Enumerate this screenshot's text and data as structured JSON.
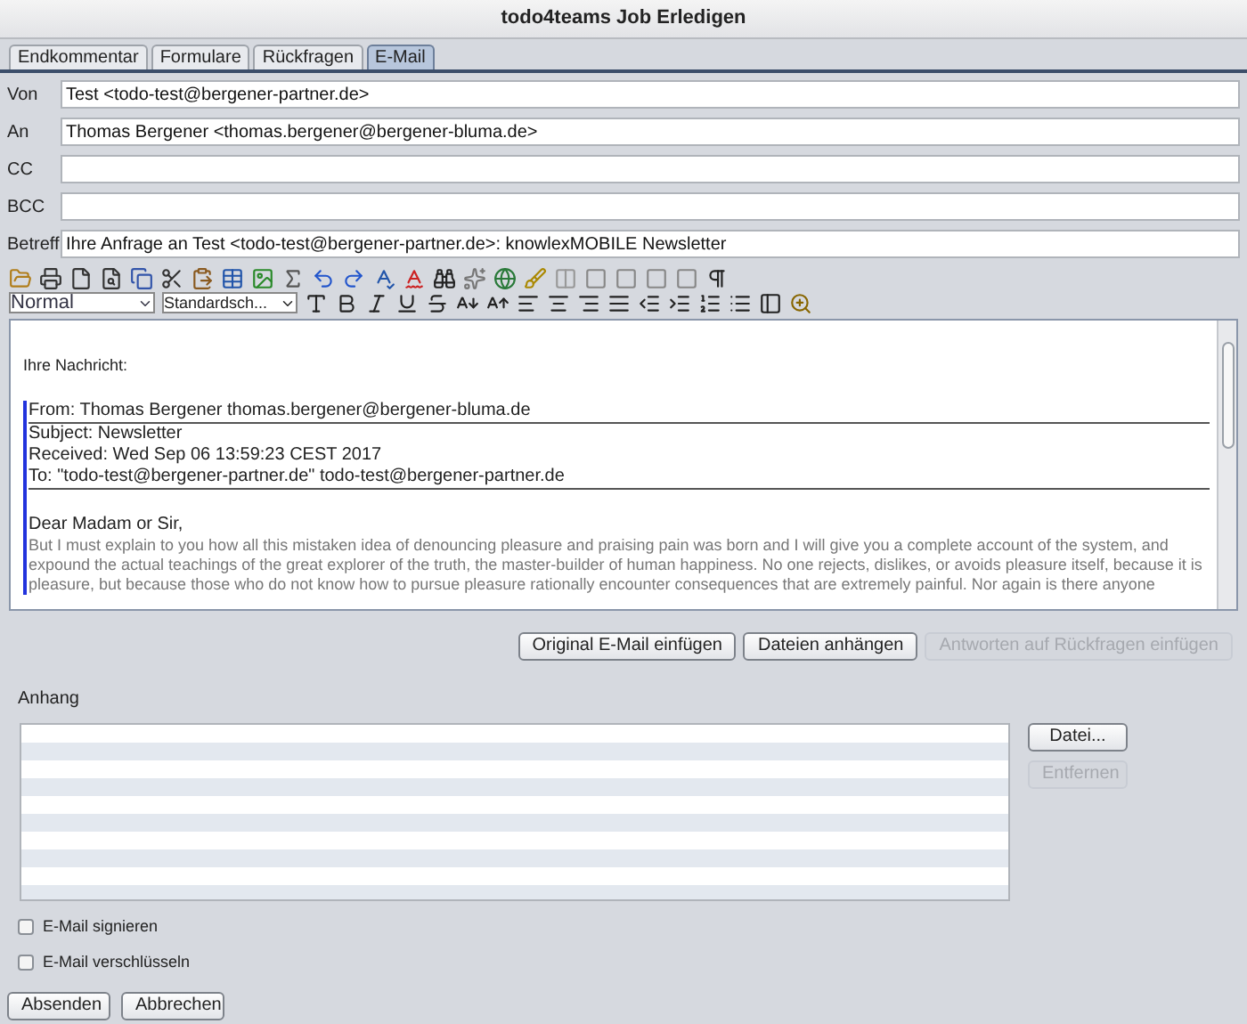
{
  "window": {
    "title": "todo4teams Job Erledigen"
  },
  "tabs": [
    {
      "label": "Endkommentar",
      "selected": false
    },
    {
      "label": "Formulare",
      "selected": false
    },
    {
      "label": "Rückfragen",
      "selected": false
    },
    {
      "label": "E-Mail",
      "selected": true
    }
  ],
  "fields": [
    {
      "label": "Von",
      "value": "Test <todo-test@bergener-partner.de>"
    },
    {
      "label": "An",
      "value": "Thomas Bergener <thomas.bergener@bergener-bluma.de>"
    },
    {
      "label": "CC"
    },
    {
      "label": "BCC"
    },
    {
      "label": "Betreff",
      "value": "Ihre Anfrage an Test <todo-test@bergener-partner.de>: knowlexMOBILE Newsletter"
    }
  ],
  "format_bar": {
    "style": "Normal",
    "font": "Standardsch..."
  },
  "editor": {
    "intro": "Ihre Nachricht:",
    "quote_header": [
      "From: Thomas Bergener  thomas.bergener@bergener-bluma.de",
      "Subject:  Newsletter",
      "Received: Wed Sep 06 13:59:23 CEST 2017",
      "To: \"todo-test@bergener-partner.de\"  todo-test@bergener-partner.de"
    ],
    "greeting": "Dear Madam or Sir,",
    "body": "But I must explain to you how all this mistaken idea of denouncing pleasure and praising pain was born and I will give you a complete account of the system, and expound the actual teachings of the great explorer of the truth, the master-builder of human happiness. No one rejects, dislikes, or avoids pleasure itself, because it is pleasure, but because those who do not know how to pursue pleasure rationally encounter consequences that are extremely painful. Nor again is there anyone"
  },
  "editor_buttons": [
    {
      "label": "Original E-Mail einfügen",
      "disabled": false
    },
    {
      "label": "Dateien anhängen",
      "disabled": false
    },
    {
      "label": "Antworten auf Rückfragen einfügen",
      "disabled": true
    }
  ],
  "attachments": {
    "label": "Anhang",
    "buttons": [
      {
        "label": "Datei...",
        "disabled": false
      },
      {
        "label": "Entfernen",
        "disabled": true
      }
    ]
  },
  "options": [
    {
      "label": "E-Mail signieren",
      "checked": false
    },
    {
      "label": "E-Mail verschlüsseln",
      "checked": false
    }
  ],
  "footer_buttons": [
    {
      "label": "Absenden",
      "disabled": false
    },
    {
      "label": "Abbrechen",
      "disabled": false
    }
  ]
}
